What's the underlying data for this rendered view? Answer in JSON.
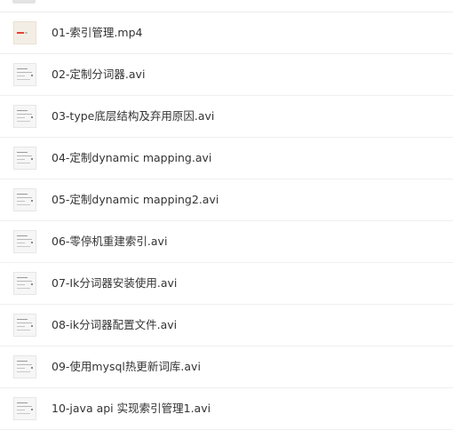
{
  "files": [
    {
      "name": "01-索引管理.mp4",
      "thumb": "video-thumbnail"
    },
    {
      "name": "02-定制分词器.avi",
      "thumb": "document-thumbnail"
    },
    {
      "name": "03-type底层结构及弃用原因.avi",
      "thumb": "document-thumbnail"
    },
    {
      "name": "04-定制dynamic mapping.avi",
      "thumb": "document-thumbnail"
    },
    {
      "name": "05-定制dynamic mapping2.avi",
      "thumb": "document-thumbnail"
    },
    {
      "name": "06-零停机重建索引.avi",
      "thumb": "document-thumbnail"
    },
    {
      "name": "07-Ik分词器安装使用.avi",
      "thumb": "document-thumbnail"
    },
    {
      "name": "08-ik分词器配置文件.avi",
      "thumb": "document-thumbnail"
    },
    {
      "name": "09-使用mysql热更新词库.avi",
      "thumb": "document-thumbnail"
    },
    {
      "name": "10-java api 实现索引管理1.avi",
      "thumb": "document-thumbnail"
    }
  ]
}
